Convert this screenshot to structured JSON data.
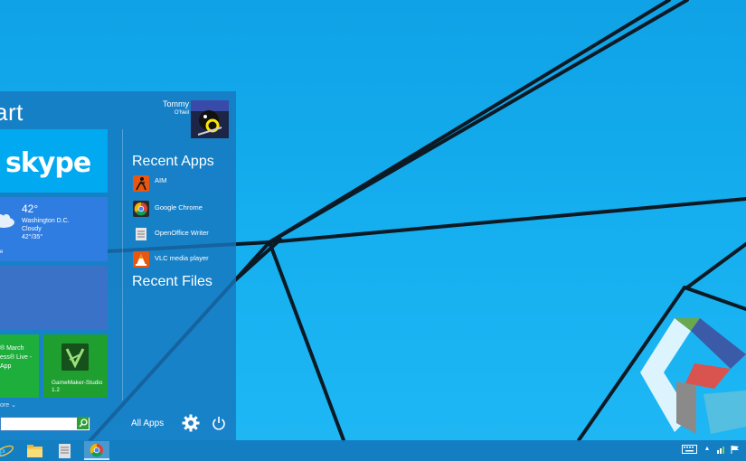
{
  "start_menu": {
    "title": "art",
    "user": {
      "first_name": "Tommy",
      "last_name": "O'Neil"
    },
    "tiles": {
      "skype": {
        "label": "skype"
      },
      "weather": {
        "temp": "42°",
        "city": "Washington D.C.",
        "condition": "Cloudy",
        "range": "42°/35°",
        "footer": "e"
      },
      "news": {
        "lines": [
          "® March",
          "ess® Live -",
          "App"
        ]
      },
      "gamemaker": {
        "label": "GameMaker-Studio",
        "version": "1.2"
      }
    },
    "more_link": "ore",
    "recent_apps_title": "Recent Apps",
    "recent_apps": [
      {
        "label": "AIM",
        "icon": "aim-icon",
        "color": "#e8570f"
      },
      {
        "label": "Google Chrome",
        "icon": "chrome-icon",
        "color": "#ffffff"
      },
      {
        "label": "OpenOffice Writer",
        "icon": "openoffice-writer-icon",
        "color": "#e6e6e6"
      },
      {
        "label": "VLC media player",
        "icon": "vlc-icon",
        "color": "#f28b00"
      }
    ],
    "recent_files_title": "Recent Files",
    "all_apps_label": "All Apps"
  },
  "taskbar": {
    "pinned": [
      {
        "name": "internet-explorer-icon"
      },
      {
        "name": "file-explorer-icon"
      },
      {
        "name": "notepad-icon"
      },
      {
        "name": "chrome-icon",
        "active": true
      }
    ],
    "tray": [
      "keyboard-icon",
      "show-hidden-icons",
      "network-icon",
      "flag-icon"
    ]
  },
  "colors": {
    "accent": "#1aa7ec",
    "start_bg": "#1876be",
    "skype_tile": "#00a9f0",
    "green_tile": "#1eae3b"
  }
}
